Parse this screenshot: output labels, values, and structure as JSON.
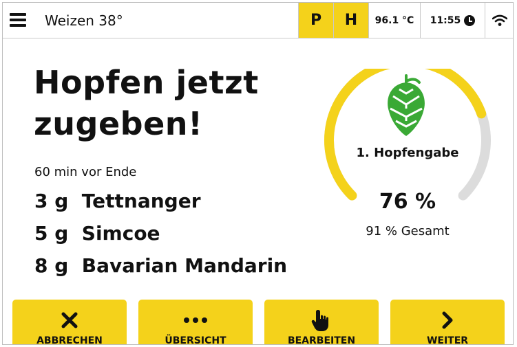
{
  "header": {
    "title": "Weizen 38°",
    "mode_p": "P",
    "mode_h": "H",
    "temperature": "96.1 °C",
    "time": "11:55",
    "icons": [
      "menu-icon",
      "clock-icon",
      "wifi-icon"
    ]
  },
  "main": {
    "headline_line1": "Hopfen jetzt",
    "headline_line2": "zugeben!",
    "timing": "60 min vor Ende",
    "hops": [
      {
        "amount": "3 g",
        "name": "Tettnanger"
      },
      {
        "amount": "5 g",
        "name": "Simcoe"
      },
      {
        "amount": "8 g",
        "name": "Bavarian Mandarin"
      }
    ]
  },
  "gauge": {
    "label": "1. Hopfengabe",
    "value_text": "76 %",
    "value": 0.76,
    "total_text": "91 % Gesamt",
    "icon": "hop-icon"
  },
  "buttons": {
    "cancel": "ABBRECHEN",
    "overview": "ÜBERSICHT",
    "edit": "BEARBEITEN",
    "next": "WEITER"
  },
  "colors": {
    "accent": "#f4d21b",
    "gauge_track": "#dcdcdc",
    "hop_green": "#3aa935",
    "text": "#111111"
  }
}
